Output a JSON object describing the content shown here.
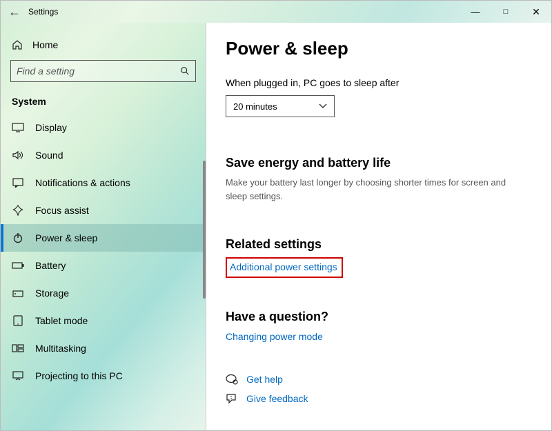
{
  "window": {
    "title": "Settings"
  },
  "sidebar": {
    "home": "Home",
    "search_placeholder": "Find a setting",
    "section": "System",
    "items": [
      {
        "icon": "display-icon",
        "label": "Display"
      },
      {
        "icon": "sound-icon",
        "label": "Sound"
      },
      {
        "icon": "notifications-icon",
        "label": "Notifications & actions"
      },
      {
        "icon": "focus-icon",
        "label": "Focus assist"
      },
      {
        "icon": "power-icon",
        "label": "Power & sleep",
        "selected": true
      },
      {
        "icon": "battery-icon",
        "label": "Battery"
      },
      {
        "icon": "storage-icon",
        "label": "Storage"
      },
      {
        "icon": "tablet-icon",
        "label": "Tablet mode"
      },
      {
        "icon": "multitask-icon",
        "label": "Multitasking"
      },
      {
        "icon": "projecting-icon",
        "label": "Projecting to this PC"
      }
    ]
  },
  "main": {
    "title": "Power & sleep",
    "plugged_label": "When plugged in, PC goes to sleep after",
    "plugged_value": "20 minutes",
    "save_heading": "Save energy and battery life",
    "save_desc": "Make your battery last longer by choosing shorter times for screen and sleep settings.",
    "related_heading": "Related settings",
    "related_link": "Additional power settings",
    "question_heading": "Have a question?",
    "question_link": "Changing power mode",
    "help_link": "Get help",
    "feedback_link": "Give feedback"
  }
}
